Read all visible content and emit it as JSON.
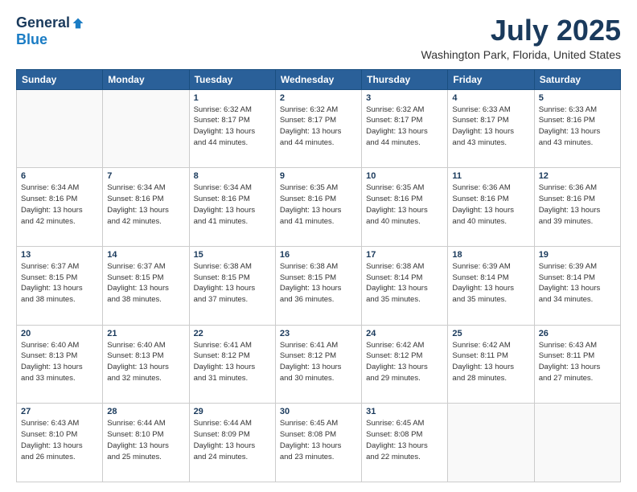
{
  "header": {
    "logo_general": "General",
    "logo_blue": "Blue",
    "title": "July 2025",
    "location": "Washington Park, Florida, United States"
  },
  "weekdays": [
    "Sunday",
    "Monday",
    "Tuesday",
    "Wednesday",
    "Thursday",
    "Friday",
    "Saturday"
  ],
  "weeks": [
    [
      {
        "day": "",
        "info": ""
      },
      {
        "day": "",
        "info": ""
      },
      {
        "day": "1",
        "info": "Sunrise: 6:32 AM\nSunset: 8:17 PM\nDaylight: 13 hours\nand 44 minutes."
      },
      {
        "day": "2",
        "info": "Sunrise: 6:32 AM\nSunset: 8:17 PM\nDaylight: 13 hours\nand 44 minutes."
      },
      {
        "day": "3",
        "info": "Sunrise: 6:32 AM\nSunset: 8:17 PM\nDaylight: 13 hours\nand 44 minutes."
      },
      {
        "day": "4",
        "info": "Sunrise: 6:33 AM\nSunset: 8:17 PM\nDaylight: 13 hours\nand 43 minutes."
      },
      {
        "day": "5",
        "info": "Sunrise: 6:33 AM\nSunset: 8:16 PM\nDaylight: 13 hours\nand 43 minutes."
      }
    ],
    [
      {
        "day": "6",
        "info": "Sunrise: 6:34 AM\nSunset: 8:16 PM\nDaylight: 13 hours\nand 42 minutes."
      },
      {
        "day": "7",
        "info": "Sunrise: 6:34 AM\nSunset: 8:16 PM\nDaylight: 13 hours\nand 42 minutes."
      },
      {
        "day": "8",
        "info": "Sunrise: 6:34 AM\nSunset: 8:16 PM\nDaylight: 13 hours\nand 41 minutes."
      },
      {
        "day": "9",
        "info": "Sunrise: 6:35 AM\nSunset: 8:16 PM\nDaylight: 13 hours\nand 41 minutes."
      },
      {
        "day": "10",
        "info": "Sunrise: 6:35 AM\nSunset: 8:16 PM\nDaylight: 13 hours\nand 40 minutes."
      },
      {
        "day": "11",
        "info": "Sunrise: 6:36 AM\nSunset: 8:16 PM\nDaylight: 13 hours\nand 40 minutes."
      },
      {
        "day": "12",
        "info": "Sunrise: 6:36 AM\nSunset: 8:16 PM\nDaylight: 13 hours\nand 39 minutes."
      }
    ],
    [
      {
        "day": "13",
        "info": "Sunrise: 6:37 AM\nSunset: 8:15 PM\nDaylight: 13 hours\nand 38 minutes."
      },
      {
        "day": "14",
        "info": "Sunrise: 6:37 AM\nSunset: 8:15 PM\nDaylight: 13 hours\nand 38 minutes."
      },
      {
        "day": "15",
        "info": "Sunrise: 6:38 AM\nSunset: 8:15 PM\nDaylight: 13 hours\nand 37 minutes."
      },
      {
        "day": "16",
        "info": "Sunrise: 6:38 AM\nSunset: 8:15 PM\nDaylight: 13 hours\nand 36 minutes."
      },
      {
        "day": "17",
        "info": "Sunrise: 6:38 AM\nSunset: 8:14 PM\nDaylight: 13 hours\nand 35 minutes."
      },
      {
        "day": "18",
        "info": "Sunrise: 6:39 AM\nSunset: 8:14 PM\nDaylight: 13 hours\nand 35 minutes."
      },
      {
        "day": "19",
        "info": "Sunrise: 6:39 AM\nSunset: 8:14 PM\nDaylight: 13 hours\nand 34 minutes."
      }
    ],
    [
      {
        "day": "20",
        "info": "Sunrise: 6:40 AM\nSunset: 8:13 PM\nDaylight: 13 hours\nand 33 minutes."
      },
      {
        "day": "21",
        "info": "Sunrise: 6:40 AM\nSunset: 8:13 PM\nDaylight: 13 hours\nand 32 minutes."
      },
      {
        "day": "22",
        "info": "Sunrise: 6:41 AM\nSunset: 8:12 PM\nDaylight: 13 hours\nand 31 minutes."
      },
      {
        "day": "23",
        "info": "Sunrise: 6:41 AM\nSunset: 8:12 PM\nDaylight: 13 hours\nand 30 minutes."
      },
      {
        "day": "24",
        "info": "Sunrise: 6:42 AM\nSunset: 8:12 PM\nDaylight: 13 hours\nand 29 minutes."
      },
      {
        "day": "25",
        "info": "Sunrise: 6:42 AM\nSunset: 8:11 PM\nDaylight: 13 hours\nand 28 minutes."
      },
      {
        "day": "26",
        "info": "Sunrise: 6:43 AM\nSunset: 8:11 PM\nDaylight: 13 hours\nand 27 minutes."
      }
    ],
    [
      {
        "day": "27",
        "info": "Sunrise: 6:43 AM\nSunset: 8:10 PM\nDaylight: 13 hours\nand 26 minutes."
      },
      {
        "day": "28",
        "info": "Sunrise: 6:44 AM\nSunset: 8:10 PM\nDaylight: 13 hours\nand 25 minutes."
      },
      {
        "day": "29",
        "info": "Sunrise: 6:44 AM\nSunset: 8:09 PM\nDaylight: 13 hours\nand 24 minutes."
      },
      {
        "day": "30",
        "info": "Sunrise: 6:45 AM\nSunset: 8:08 PM\nDaylight: 13 hours\nand 23 minutes."
      },
      {
        "day": "31",
        "info": "Sunrise: 6:45 AM\nSunset: 8:08 PM\nDaylight: 13 hours\nand 22 minutes."
      },
      {
        "day": "",
        "info": ""
      },
      {
        "day": "",
        "info": ""
      }
    ]
  ]
}
